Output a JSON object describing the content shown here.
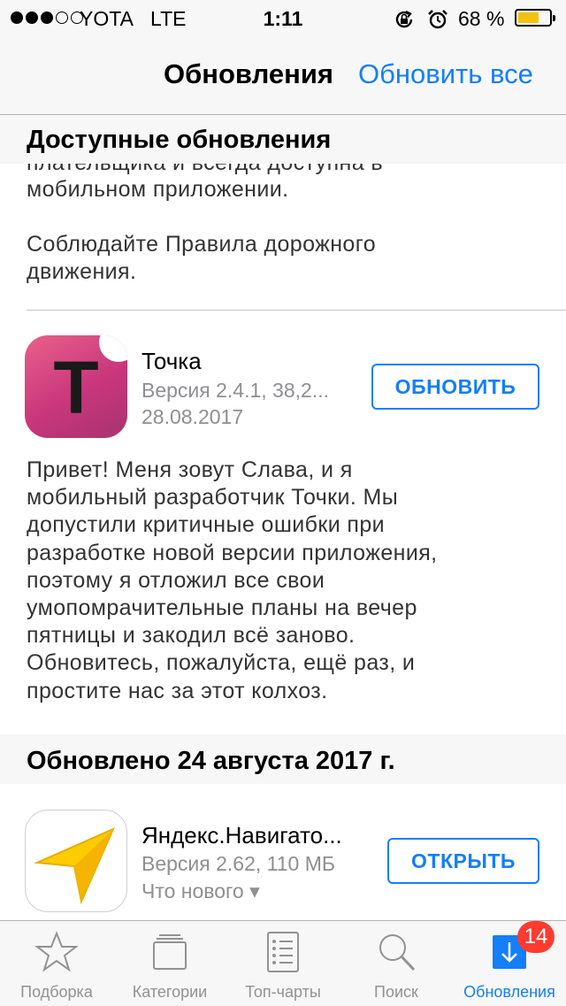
{
  "status_bar": {
    "carrier": "YOTA",
    "network": "LTE",
    "time": "1:11",
    "battery_percent": "68 %",
    "battery_level": 0.68,
    "battery_color": "#f4c20d"
  },
  "nav": {
    "title": "Обновления",
    "action": "Обновить все"
  },
  "sections": {
    "available": "Доступные обновления",
    "updated": "Обновлено 24 августа 2017 г."
  },
  "previous_notes": {
    "line_partial": "плательщика и всегда доступна в",
    "line1": "мобильном приложении.",
    "line2": "Соблюдайте Правила дорожного",
    "line3": "движения."
  },
  "tochka": {
    "icon_letter": "Т",
    "name": "Точка",
    "version": "Версия 2.4.1, 38,2...",
    "date": "28.08.2017",
    "button": "ОБНОВИТЬ",
    "notes": [
      "Привет! Меня зовут Слава, и я",
      "мобильный разработчик Точки. Мы",
      "допустили критичные ошибки при",
      "разработке новой версии приложения,",
      "поэтому я отложил все свои",
      "умопомрачительные планы на вечер",
      "пятницы и закодил всё заново.",
      "Обновитесь, пожалуйста, ещё раз, и",
      "простите нас за этот колхоз."
    ]
  },
  "yandex": {
    "name": "Яндекс.Навигато...",
    "version": "Версия 2.62, 110 МБ",
    "whats_new": "Что нового ▾",
    "button": "ОТКРЫТЬ"
  },
  "tabs": [
    {
      "label": "Подборка",
      "icon": "star-icon"
    },
    {
      "label": "Категории",
      "icon": "categories-icon"
    },
    {
      "label": "Топ-чарты",
      "icon": "top-charts-icon"
    },
    {
      "label": "Поиск",
      "icon": "search-icon"
    },
    {
      "label": "Обновления",
      "icon": "updates-icon"
    }
  ],
  "badge": "14",
  "colors": {
    "accent": "#147efb",
    "badge": "#ff3b30"
  }
}
